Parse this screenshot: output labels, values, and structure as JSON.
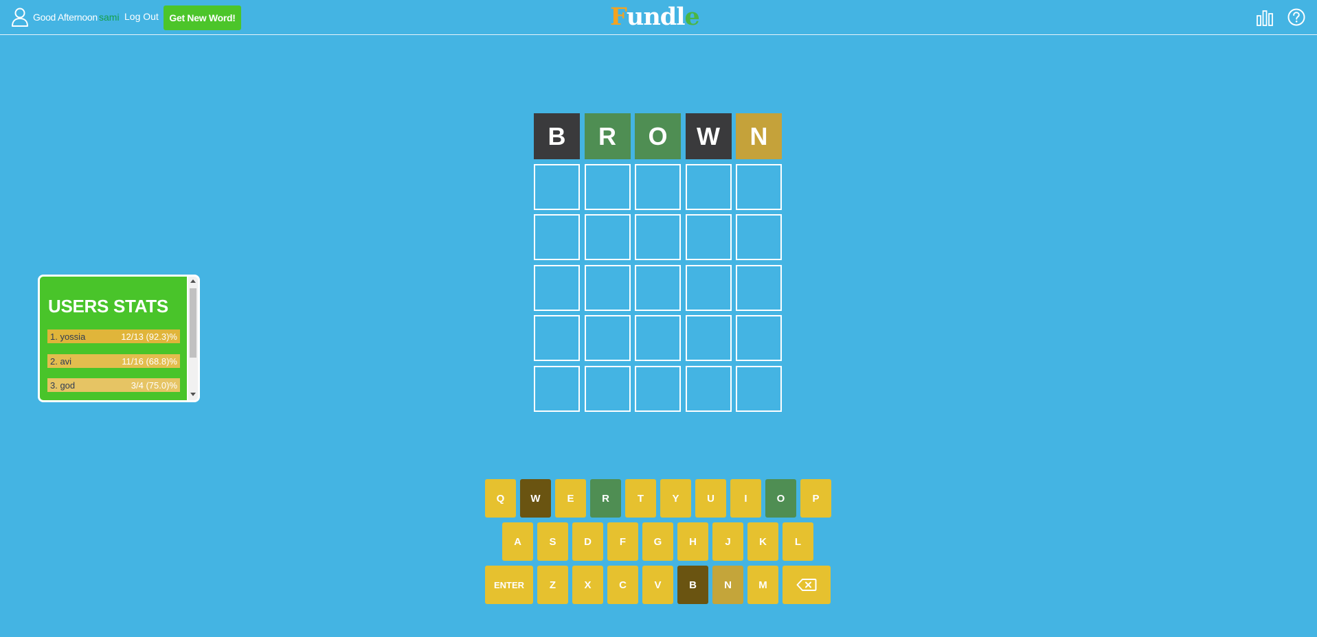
{
  "header": {
    "greeting": "Good Afternoon",
    "username": "sami",
    "logout_label": "Log Out",
    "new_word_label": "Get New Word!",
    "logo_letters": [
      {
        "char": "F",
        "color": "#f4a320"
      },
      {
        "char": "u",
        "color": "#ffffff"
      },
      {
        "char": "n",
        "color": "#ffffff"
      },
      {
        "char": "d",
        "color": "#ffffff"
      },
      {
        "char": "l",
        "color": "#ffffff"
      },
      {
        "char": "e",
        "color": "#4bb545"
      }
    ],
    "icons": [
      "user-icon",
      "stats-icon",
      "help-icon"
    ]
  },
  "colors": {
    "background": "#44b4e3",
    "correct": "#4f8e53",
    "present": "#c5a23a",
    "absent": "#3a3a3c",
    "key_default": "#e6c12f",
    "key_absent": "#6a5411",
    "key_present": "#c4a53a"
  },
  "board": {
    "rows": [
      [
        {
          "letter": "B",
          "state": "absent"
        },
        {
          "letter": "R",
          "state": "correct"
        },
        {
          "letter": "O",
          "state": "correct"
        },
        {
          "letter": "W",
          "state": "absent"
        },
        {
          "letter": "N",
          "state": "present"
        }
      ],
      [
        {
          "letter": "",
          "state": "empty"
        },
        {
          "letter": "",
          "state": "empty"
        },
        {
          "letter": "",
          "state": "empty"
        },
        {
          "letter": "",
          "state": "empty"
        },
        {
          "letter": "",
          "state": "empty"
        }
      ],
      [
        {
          "letter": "",
          "state": "empty"
        },
        {
          "letter": "",
          "state": "empty"
        },
        {
          "letter": "",
          "state": "empty"
        },
        {
          "letter": "",
          "state": "empty"
        },
        {
          "letter": "",
          "state": "empty"
        }
      ],
      [
        {
          "letter": "",
          "state": "empty"
        },
        {
          "letter": "",
          "state": "empty"
        },
        {
          "letter": "",
          "state": "empty"
        },
        {
          "letter": "",
          "state": "empty"
        },
        {
          "letter": "",
          "state": "empty"
        }
      ],
      [
        {
          "letter": "",
          "state": "empty"
        },
        {
          "letter": "",
          "state": "empty"
        },
        {
          "letter": "",
          "state": "empty"
        },
        {
          "letter": "",
          "state": "empty"
        },
        {
          "letter": "",
          "state": "empty"
        }
      ],
      [
        {
          "letter": "",
          "state": "empty"
        },
        {
          "letter": "",
          "state": "empty"
        },
        {
          "letter": "",
          "state": "empty"
        },
        {
          "letter": "",
          "state": "empty"
        },
        {
          "letter": "",
          "state": "empty"
        }
      ]
    ]
  },
  "stats": {
    "title": "USERS STATS",
    "entries": [
      {
        "name": "1. yossia",
        "score": "12/13 (92.3)%",
        "color": "#e0b53a"
      },
      {
        "name": "2. avi",
        "score": "11/16 (68.8)%",
        "color": "#e3bd4e"
      },
      {
        "name": "3. god",
        "score": "3/4 (75.0)%",
        "color": "#e6c464"
      }
    ]
  },
  "keyboard": {
    "rows": [
      [
        {
          "label": "Q",
          "state": "default"
        },
        {
          "label": "W",
          "state": "absent"
        },
        {
          "label": "E",
          "state": "default"
        },
        {
          "label": "R",
          "state": "correct"
        },
        {
          "label": "T",
          "state": "default"
        },
        {
          "label": "Y",
          "state": "default"
        },
        {
          "label": "U",
          "state": "default"
        },
        {
          "label": "I",
          "state": "default"
        },
        {
          "label": "O",
          "state": "correct"
        },
        {
          "label": "P",
          "state": "default"
        }
      ],
      [
        {
          "label": "A",
          "state": "default"
        },
        {
          "label": "S",
          "state": "default"
        },
        {
          "label": "D",
          "state": "default"
        },
        {
          "label": "F",
          "state": "default"
        },
        {
          "label": "G",
          "state": "default"
        },
        {
          "label": "H",
          "state": "default"
        },
        {
          "label": "J",
          "state": "default"
        },
        {
          "label": "K",
          "state": "default"
        },
        {
          "label": "L",
          "state": "default"
        }
      ],
      [
        {
          "label": "ENTER",
          "state": "default",
          "wide": true
        },
        {
          "label": "Z",
          "state": "default"
        },
        {
          "label": "X",
          "state": "default"
        },
        {
          "label": "C",
          "state": "default"
        },
        {
          "label": "V",
          "state": "default"
        },
        {
          "label": "B",
          "state": "absent"
        },
        {
          "label": "N",
          "state": "present"
        },
        {
          "label": "M",
          "state": "default"
        },
        {
          "label": "",
          "state": "default",
          "wide": true,
          "icon": "backspace-icon"
        }
      ]
    ]
  }
}
